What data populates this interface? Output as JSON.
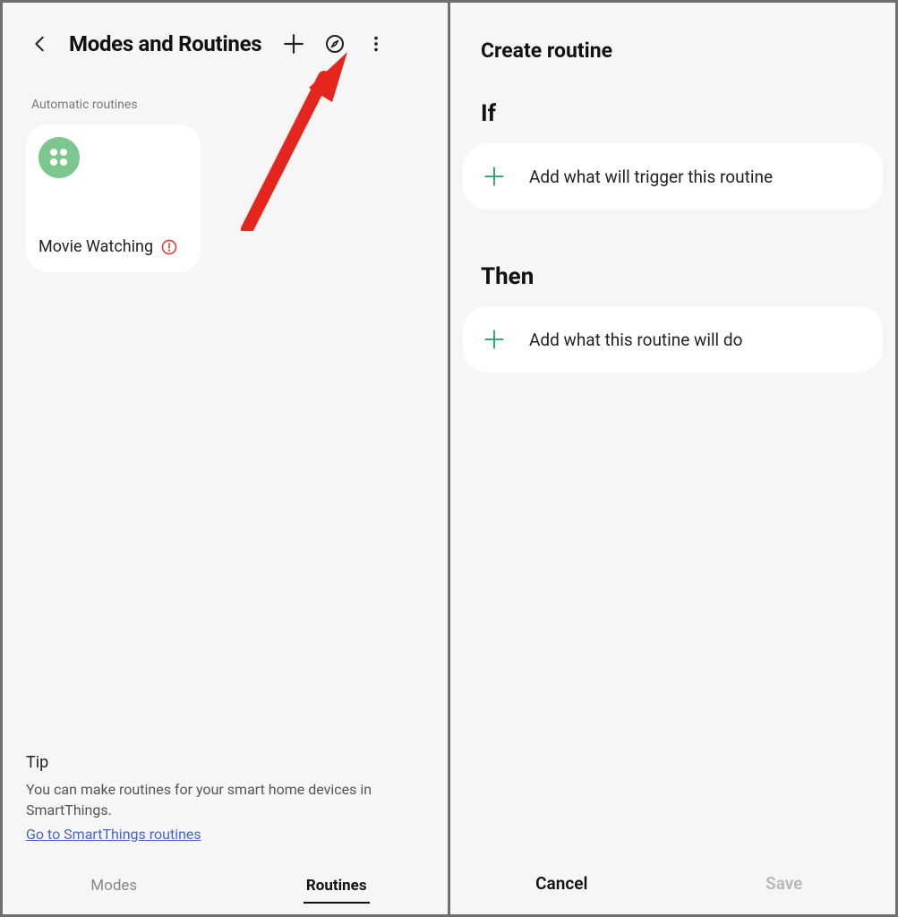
{
  "left": {
    "title": "Modes and Routines",
    "section_label": "Automatic routines",
    "routine": {
      "name": "Movie Watching"
    },
    "tip": {
      "heading": "Tip",
      "body": "You can make routines for your smart home devices in SmartThings.",
      "link_text": "Go to SmartThings routines"
    },
    "tabs": {
      "modes": "Modes",
      "routines": "Routines"
    }
  },
  "right": {
    "title": "Create routine",
    "if_label": "If",
    "if_add": "Add what will trigger this routine",
    "then_label": "Then",
    "then_add": "Add what this routine will do",
    "cancel": "Cancel",
    "save": "Save"
  }
}
